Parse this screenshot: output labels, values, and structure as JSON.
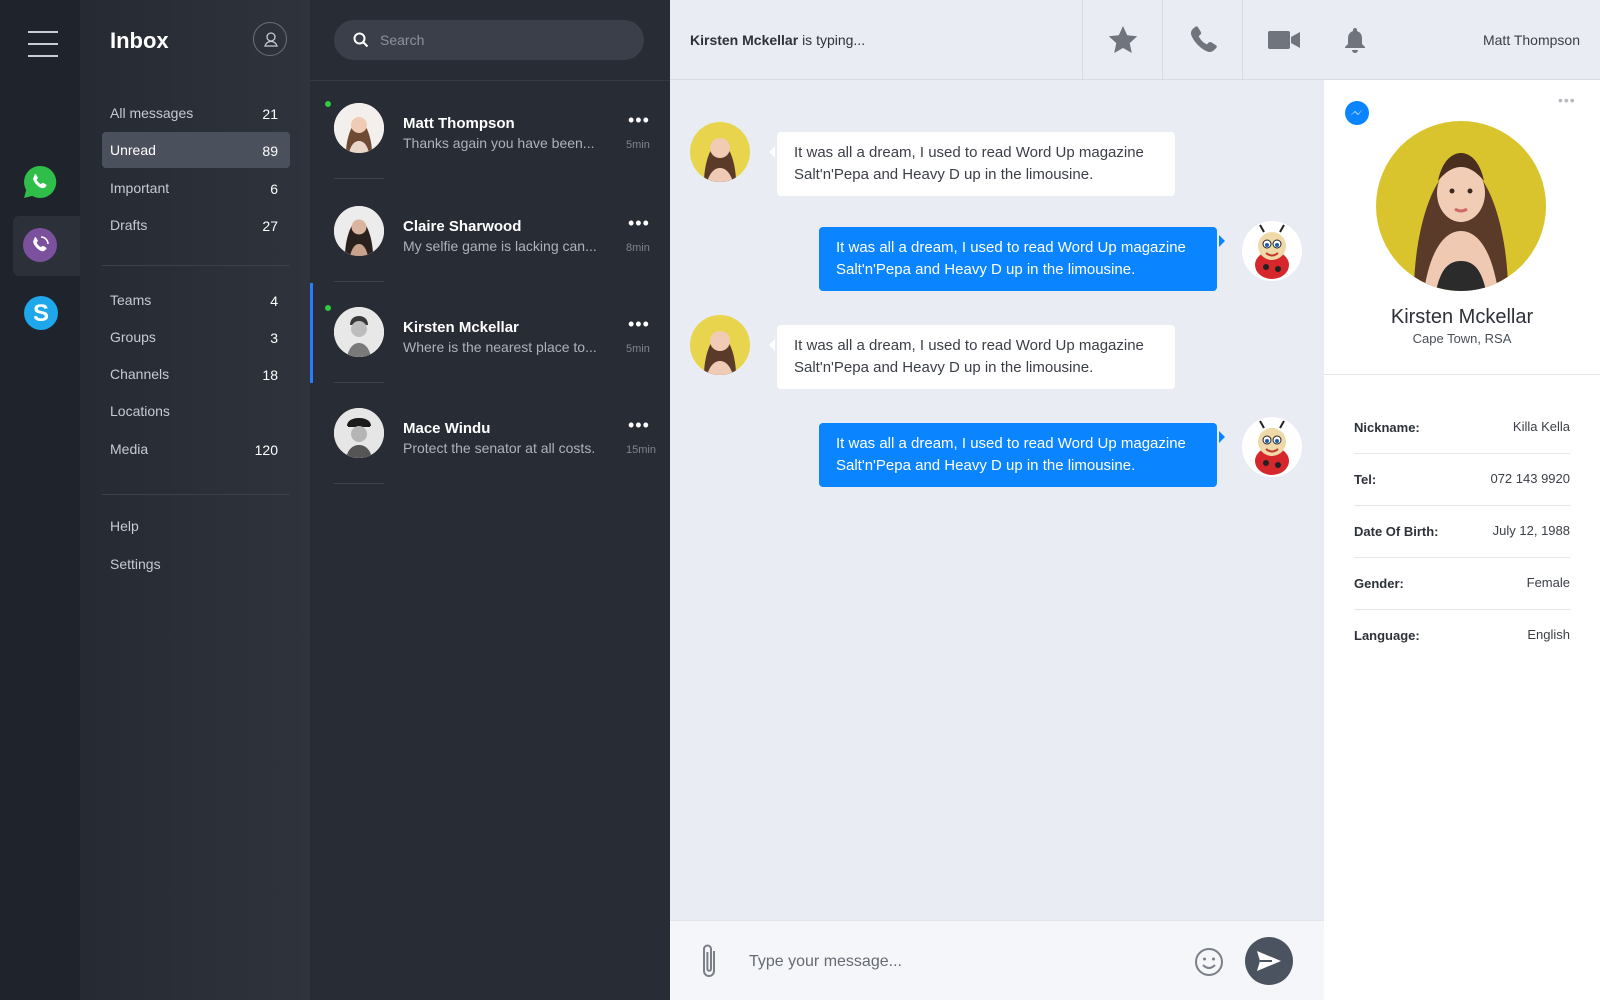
{
  "sidebar": {
    "title": "Inbox",
    "groups": [
      {
        "label": "All messages",
        "count": "21"
      },
      {
        "label": "Unread",
        "count": "89"
      },
      {
        "label": "Important",
        "count": "6"
      },
      {
        "label": "Drafts",
        "count": "27"
      },
      {
        "label": "Teams",
        "count": "4"
      },
      {
        "label": "Groups",
        "count": "3"
      },
      {
        "label": "Channels",
        "count": "18"
      },
      {
        "label": "Locations",
        "count": ""
      },
      {
        "label": "Media",
        "count": "120"
      },
      {
        "label": "Help",
        "count": ""
      },
      {
        "label": "Settings",
        "count": ""
      }
    ],
    "active": "Unread"
  },
  "apps": [
    "whatsapp-icon",
    "viber-icon",
    "skype-icon"
  ],
  "search": {
    "placeholder": "Search"
  },
  "conversations": [
    {
      "name": "Matt Thompson",
      "preview": "Thanks again you have been...",
      "time": "5min",
      "online": true
    },
    {
      "name": "Claire Sharwood",
      "preview": "My selfie game is lacking can...",
      "time": "8min",
      "online": false
    },
    {
      "name": "Kirsten Mckellar",
      "preview": "Where is the nearest place to...",
      "time": "5min",
      "online": true
    },
    {
      "name": "Mace Windu",
      "preview": "Protect the senator at all costs.",
      "time": "15min",
      "online": false
    }
  ],
  "chat": {
    "typing_name": "Kirsten Mckellar",
    "typing_suffix": "is typing...",
    "messages": [
      {
        "direction": "in",
        "line1": "It was all a dream, I used to read Word Up magazine",
        "line2": "Salt'n'Pepa and Heavy D up in the limousine."
      },
      {
        "direction": "out",
        "line1": "It was all a dream, I used to read Word Up magazine",
        "line2": "Salt'n'Pepa and Heavy D up in the limousine."
      },
      {
        "direction": "in",
        "line1": "It was all a dream, I used to read Word Up magazine",
        "line2": "Salt'n'Pepa and Heavy D up in the limousine."
      },
      {
        "direction": "out",
        "line1": "It was all a dream, I used to read Word Up magazine",
        "line2": "Salt'n'Pepa and Heavy D up in the limousine."
      }
    ],
    "composer_placeholder": "Type your message..."
  },
  "profile": {
    "current_user": "Matt Thompson",
    "name": "Kirsten Mckellar",
    "location": "Cape Town, RSA",
    "fields": [
      {
        "key": "Nickname:",
        "value": "Killa Kella"
      },
      {
        "key": "Tel:",
        "value": "072 143 9920"
      },
      {
        "key": "Date Of Birth:",
        "value": "July 12, 1988"
      },
      {
        "key": "Gender:",
        "value": "Female"
      },
      {
        "key": "Language:",
        "value": "English"
      }
    ]
  },
  "colors": {
    "accent": "#0a84ff",
    "online": "#2ecc40",
    "rail": "#1f232b",
    "nav": "#2a2e37",
    "list": "#282c35"
  }
}
